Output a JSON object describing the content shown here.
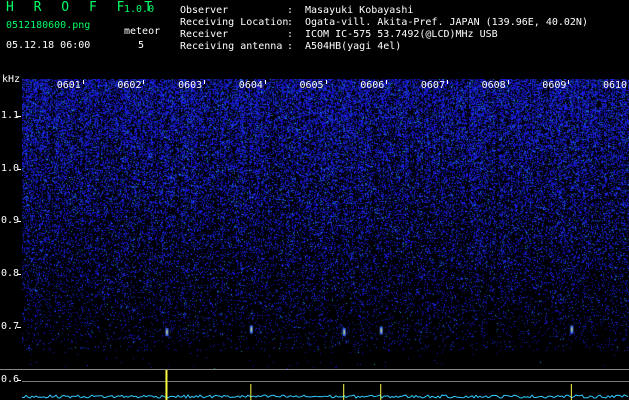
{
  "header": {
    "app_title": "H R O F F T",
    "app_version": "1.0.0",
    "file_name": "0512180600.png",
    "datetime": "05.12.18 06:00",
    "meteor_label": "meteor",
    "meteor_count": "5"
  },
  "info": [
    {
      "label": "Observer",
      "sep": ":",
      "value": "Masayuki Kobayashi"
    },
    {
      "label": "Receiving Location",
      "sep": ":",
      "value": "Ogata-vill. Akita-Pref. JAPAN (139.96E, 40.02N)"
    },
    {
      "label": "Receiver",
      "sep": ":",
      "value": "ICOM IC-575 53.7492(@LCD)MHz USB"
    },
    {
      "label": "Receiving antenna",
      "sep": ":",
      "value": "A504HB(yagi 4el)"
    }
  ],
  "axis": {
    "y_unit": "kHz",
    "y_ticks": [
      "1.1",
      "1.0",
      "0.9",
      "0.8",
      "0.7",
      "0.6"
    ],
    "y_values": [
      1.1,
      1.0,
      0.9,
      0.8,
      0.7,
      0.6
    ],
    "x_ticks": [
      "0601",
      "0602",
      "0603",
      "0604",
      "0605",
      "0606",
      "0607",
      "0608",
      "0609",
      "0610"
    ],
    "x_values": [
      1,
      2,
      3,
      4,
      5,
      6,
      7,
      8,
      9,
      10
    ],
    "x_range_minutes": [
      0,
      10
    ],
    "y_range_khz": [
      0.62,
      1.17
    ]
  },
  "colors": {
    "title_green": "#00ff66",
    "noise_blue": "#1a2cff",
    "signal_yellow": "#ffff44",
    "meter_cyan": "#33ccff"
  },
  "meteor_echoes": [
    {
      "minute": 2.38,
      "freq_khz": 0.69
    },
    {
      "minute": 3.77,
      "freq_khz": 0.695
    },
    {
      "minute": 5.3,
      "freq_khz": 0.69
    },
    {
      "minute": 5.91,
      "freq_khz": 0.693
    },
    {
      "minute": 9.05,
      "freq_khz": 0.695
    }
  ]
}
